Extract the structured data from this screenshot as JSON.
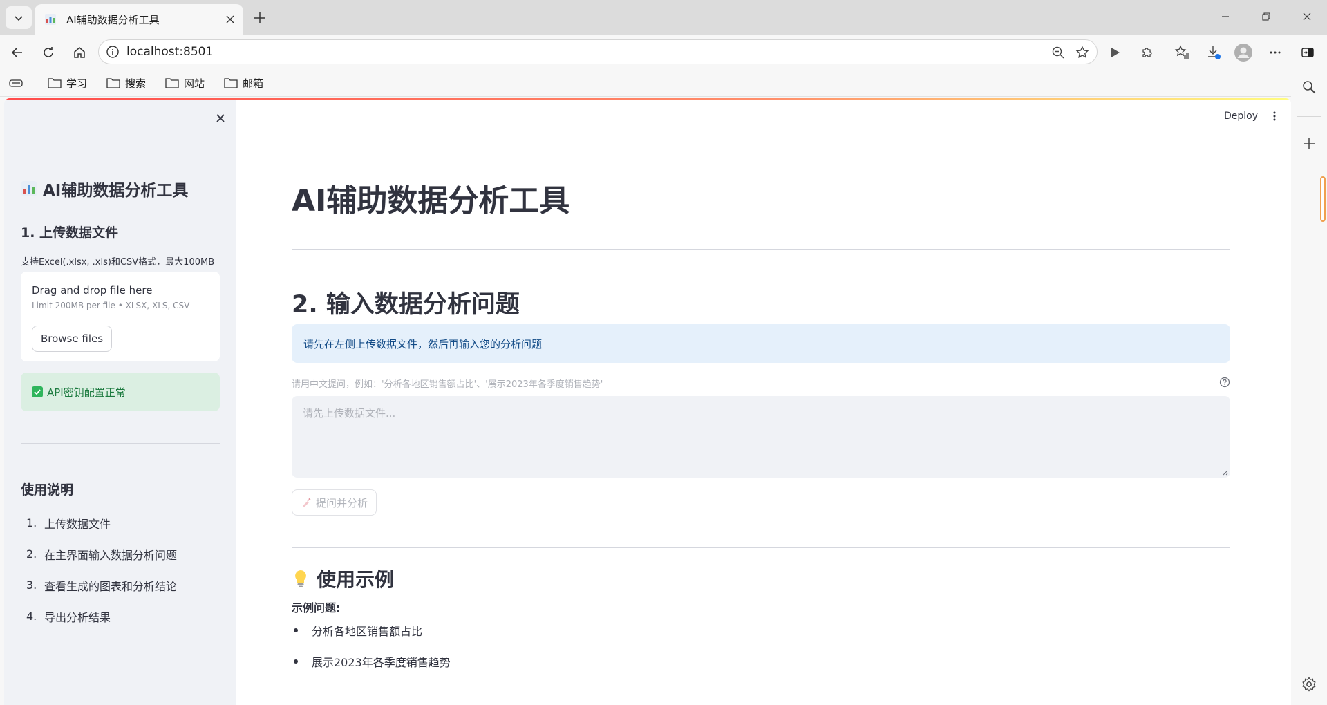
{
  "browser": {
    "tab_title": "AI辅助数据分析工具",
    "url": "localhost:8501",
    "bookmarks": [
      "学习",
      "搜索",
      "网站",
      "邮箱"
    ]
  },
  "app": {
    "deploy_label": "Deploy",
    "sidebar": {
      "title": "AI辅助数据分析工具",
      "title_icon": "bar-chart-icon",
      "upload_heading": "1. 上传数据文件",
      "upload_caption": "支持Excel(.xlsx, .xls)和CSV格式，最大100MB",
      "dropzone_title": "Drag and drop file here",
      "dropzone_limit": "Limit 200MB per file • XLSX, XLS, CSV",
      "browse_label": "Browse files",
      "api_status": "API密钥配置正常",
      "instructions_heading": "使用说明",
      "steps": [
        {
          "num": "1.",
          "text": "上传数据文件"
        },
        {
          "num": "2.",
          "text": "在主界面输入数据分析问题"
        },
        {
          "num": "3.",
          "text": "查看生成的图表和分析结论"
        },
        {
          "num": "4.",
          "text": "导出分析结果"
        }
      ]
    },
    "main": {
      "title": "AI辅助数据分析工具",
      "question_heading": "2. 输入数据分析问题",
      "info_message": "请先在左侧上传数据文件，然后再输入您的分析问题",
      "question_label": "请用中文提问，例如：'分析各地区销售额占比'、'展示2023年各季度销售趋势'",
      "question_placeholder": "请先上传数据文件...",
      "ask_button": "提问并分析",
      "examples_heading": "使用示例",
      "examples_icon": "lightbulb-icon",
      "examples_label": "示例问题:",
      "examples": [
        "分析各地区销售额占比",
        "展示2023年各季度销售趋势"
      ]
    }
  }
}
